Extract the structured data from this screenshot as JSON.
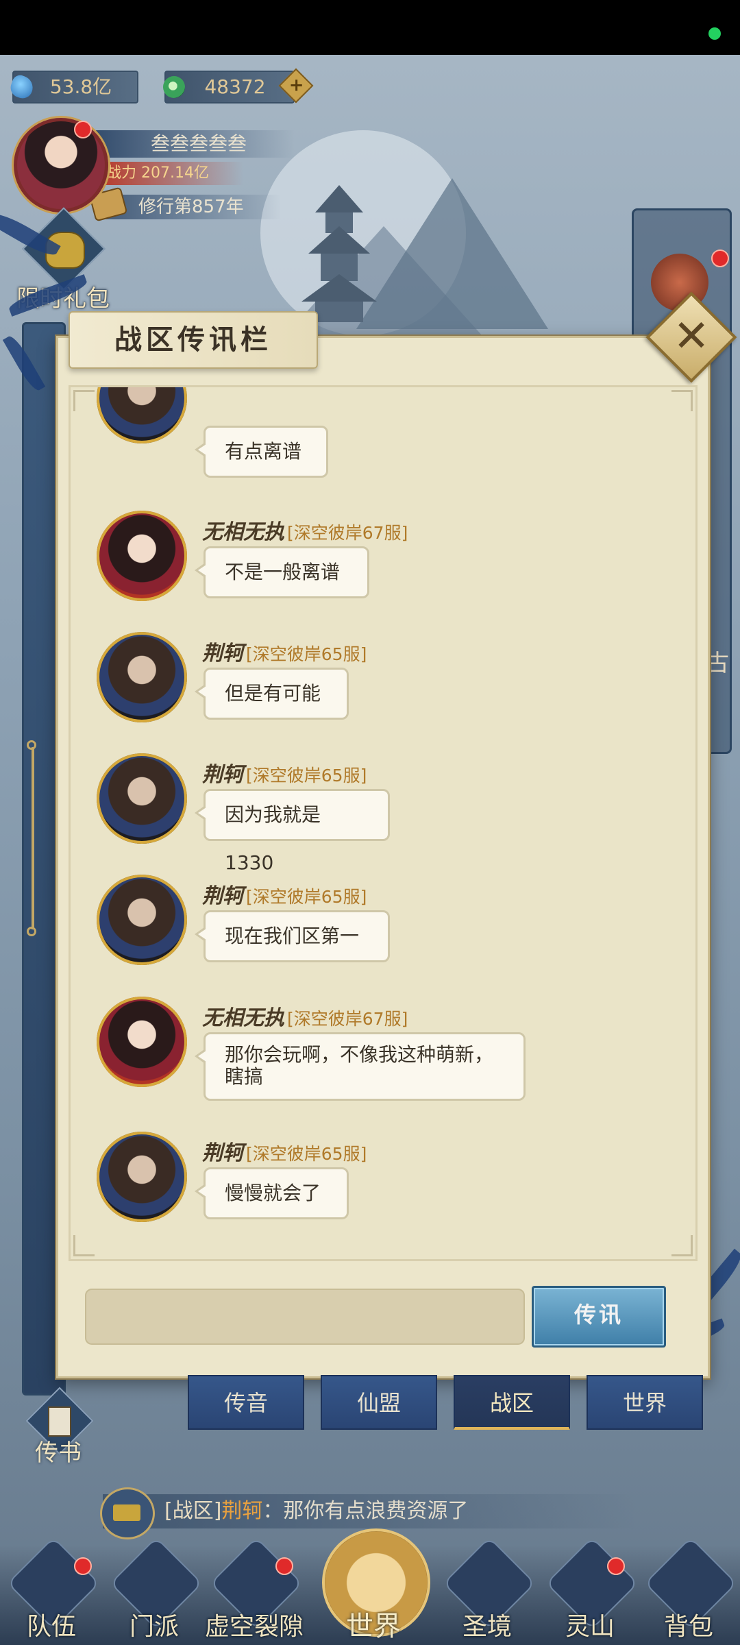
{
  "hud": {
    "spirit_stones": "53.8亿",
    "jade": "48372",
    "plus": "+",
    "player_name": "叁叁叁叁叁",
    "combat_power_label": "战力",
    "combat_power": "207.14亿",
    "cultivation": "修行第857年",
    "limited_gift": "限时礼包",
    "right_edge_text": "古"
  },
  "dialog": {
    "title": "战区传讯栏",
    "close": "✕",
    "messages": [
      {
        "name": "",
        "server": "",
        "text": "有点离谱",
        "avatar": "jing-ke"
      },
      {
        "name": "无相无执",
        "server": "[深空彼岸67服]",
        "text": "不是一般离谱",
        "avatar": "wuxiang"
      },
      {
        "name": "荆轲",
        "server": "[深空彼岸65服]",
        "text": "但是有可能",
        "avatar": "jing-ke"
      },
      {
        "name": "荆轲",
        "server": "[深空彼岸65服]",
        "text": "因为我就是1330",
        "avatar": "jing-ke"
      },
      {
        "name": "荆轲",
        "server": "[深空彼岸65服]",
        "text": "现在我们区第一",
        "avatar": "jing-ke"
      },
      {
        "name": "无相无执",
        "server": "[深空彼岸67服]",
        "text": "那你会玩啊，不像我这种萌新，",
        "text2": "瞎搞",
        "avatar": "wuxiang"
      },
      {
        "name": "荆轲",
        "server": "[深空彼岸65服]",
        "text": "慢慢就会了",
        "avatar": "jing-ke"
      }
    ],
    "input_placeholder": "",
    "send_label": "传讯"
  },
  "tabs": [
    {
      "label": "传音",
      "active": false
    },
    {
      "label": "仙盟",
      "active": false
    },
    {
      "label": "战区",
      "active": true
    },
    {
      "label": "世界",
      "active": false
    }
  ],
  "side": {
    "scroll_label": "传书"
  },
  "ticker": {
    "channel": "[战区]",
    "sender": "荆轲",
    "text": "：那你有点浪费资源了"
  },
  "nav": [
    {
      "label": "队伍"
    },
    {
      "label": "门派"
    },
    {
      "label": "虚空裂隙"
    },
    {
      "label": "世界"
    },
    {
      "label": "圣境"
    },
    {
      "label": "灵山"
    },
    {
      "label": "背包"
    }
  ],
  "colors": {
    "dialog_bg": "#ece6cb",
    "name_server": "#b07a2a",
    "active_tab_underline": "#e1b65a",
    "send_button": "#3f7fa8"
  }
}
